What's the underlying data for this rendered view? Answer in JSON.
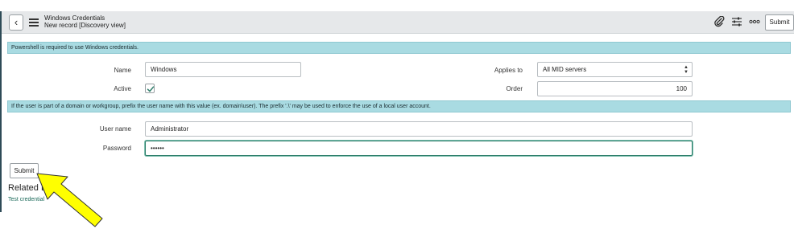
{
  "header": {
    "title": "Windows Credentials",
    "subtitle": "New record [Discovery view]",
    "submit_label": "Submit",
    "back_icon": "chevron-left-icon",
    "menu_icon": "hamburger-icon",
    "attach_icon": "paperclip-icon",
    "settings_icon": "sliders-icon",
    "more_icon": "more-icon"
  },
  "banners": {
    "powershell": "Powershell is required to use Windows credentials.",
    "domain": "If the user is part of a domain or workgroup, prefix the user name with this value (ex. domain\\user). The prefix '.\\' may be used to enforce the use of a local user account."
  },
  "form": {
    "name_label": "Name",
    "name_value": "Windows",
    "active_label": "Active",
    "active_checked": true,
    "applies_label": "Applies to",
    "applies_value": "All MID servers",
    "order_label": "Order",
    "order_value": "100",
    "username_label": "User name",
    "username_value": "Administrator",
    "password_label": "Password",
    "password_value": "••••••"
  },
  "footer": {
    "submit_label": "Submit",
    "related_title": "Related Links",
    "test_link": "Test credential"
  },
  "colors": {
    "banner": "#a9dbe2",
    "link": "#1d6b5b",
    "annotation_arrow": "#ffff00"
  }
}
